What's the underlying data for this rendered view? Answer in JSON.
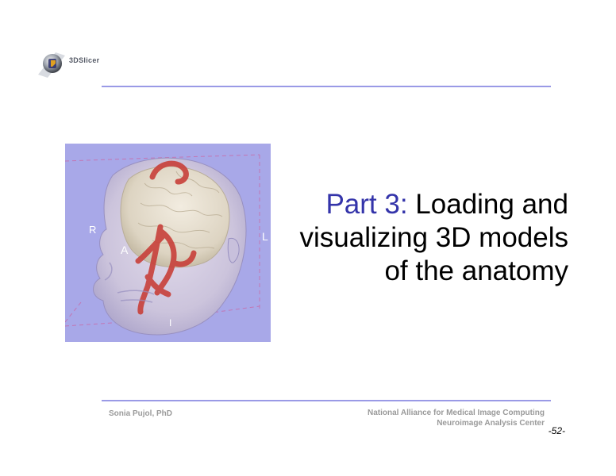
{
  "header": {
    "logo_text": "3DSlicer"
  },
  "image": {
    "orientation_labels": {
      "right": "R",
      "left": "L",
      "anterior": "A",
      "inferior": "I"
    }
  },
  "title": {
    "part": "Part 3:",
    "line1": "Loading and",
    "line2": "visualizing 3D models",
    "line3": "of the anatomy"
  },
  "footer": {
    "author": "Sonia Pujol, PhD",
    "org_line1": "National Alliance for Medical Image Computing",
    "org_line2": "Neuroimage Analysis Center",
    "page_number": "-52-"
  },
  "colors": {
    "accent_blue": "#3434aa",
    "rule": "#9a9ae6",
    "image_background": "#a8a8e8",
    "vessels": "#c8403a",
    "brain": "#e8e0d0",
    "skin": "#d8d0e0"
  }
}
